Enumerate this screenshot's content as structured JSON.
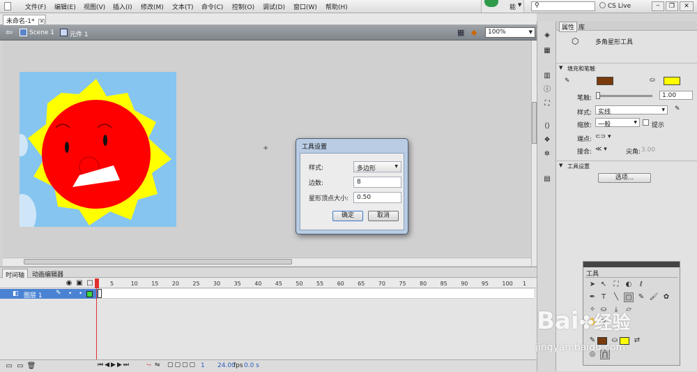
{
  "menubar": {
    "items": [
      "文件(F)",
      "编辑(E)",
      "视图(V)",
      "插入(I)",
      "修改(M)",
      "文本(T)",
      "命令(C)",
      "控制(O)",
      "调试(D)",
      "窗口(W)",
      "帮助(H)"
    ],
    "workspace_label": "能",
    "cslive_label": "CS Live"
  },
  "document": {
    "tab_title": "未命名-1*",
    "scene_label": "Scene 1",
    "symbol_label": "元件 1",
    "zoom": "100%"
  },
  "dialog": {
    "title": "工具设置",
    "style_label": "样式:",
    "style_value": "多边形",
    "sides_label": "边数:",
    "sides_value": "8",
    "star_label": "星形顶点大小:",
    "star_value": "0.50",
    "ok_label": "确定",
    "cancel_label": "取消"
  },
  "timeline": {
    "tab_timeline": "时间轴",
    "tab_motion": "动画编辑器",
    "layer_name": "图层 1",
    "frame_numbers": [
      "5",
      "10",
      "15",
      "20",
      "25",
      "30",
      "35",
      "40",
      "45",
      "50",
      "55",
      "60",
      "65",
      "70",
      "75",
      "80",
      "85",
      "90",
      "95",
      "100",
      "1"
    ],
    "current_frame": "1",
    "fps": "24.00",
    "fps_unit": "fps",
    "time": "0.0 s"
  },
  "properties": {
    "tab_properties": "属性",
    "tab_library": "库",
    "tool_name": "多角星形工具",
    "section_fill_stroke": "填充和笔触",
    "stroke_color": "#7a3b0c",
    "fill_color": "#ffff00",
    "stroke_label": "笔触:",
    "stroke_value": "1.00",
    "style_label": "样式:",
    "style_value": "实线",
    "scale_label": "缩放:",
    "scale_value": "一般",
    "hint_label": "提示",
    "cap_label": "端点:",
    "join_label": "接合:",
    "miter_label": "尖角:",
    "miter_value": "3.00",
    "section_tool_settings": "工具设置",
    "options_button": "选项..."
  },
  "tools_panel": {
    "title": "工具"
  },
  "watermark": {
    "line1": "Bai",
    "line1b": "经验",
    "line2": "jingyan.baidu.com"
  },
  "colors": {
    "sky": "#86c5ef",
    "sun_rays": "#ffff00",
    "sun_face": "#ff0000",
    "playhead": "#e03030"
  }
}
